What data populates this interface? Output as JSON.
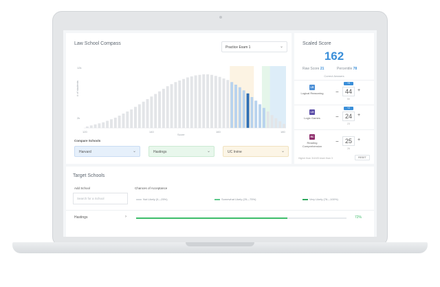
{
  "compass": {
    "title": "Law School Compass",
    "exam_select": "Practice Exam 1",
    "compare_label": "Compare Schools",
    "compare_schools": [
      "Harvard",
      "Hastings",
      "UC Irvine"
    ]
  },
  "chart_data": {
    "type": "bar",
    "ylabel": "# of students",
    "xlabel": "Score",
    "x_ticks": [
      "120",
      "140",
      "160",
      "180"
    ],
    "y_ticks": [
      "12k",
      "2k"
    ],
    "values": [
      0.3,
      0.5,
      0.7,
      0.9,
      1.1,
      1.4,
      1.7,
      2.0,
      2.4,
      2.8,
      3.2,
      3.6,
      4.1,
      4.6,
      5.1,
      5.6,
      6.1,
      6.6,
      7.1,
      7.6,
      8.1,
      8.5,
      8.9,
      9.2,
      9.5,
      9.8,
      10.0,
      10.2,
      10.3,
      10.4,
      10.4,
      10.3,
      10.1,
      9.9,
      9.6,
      9.3,
      8.9,
      8.4,
      7.9,
      7.3,
      6.7,
      6.0,
      5.3,
      4.6,
      3.9,
      3.2,
      2.5,
      1.9,
      1.3,
      0.8
    ],
    "ylim": [
      0,
      12
    ],
    "highlight_index": 40,
    "colors": {
      "bar": "#e3e5e8",
      "highlight_bar": "#b9d3ee",
      "selected_bar": "#2f6fb4",
      "harvard_band": "#dcebfa",
      "hastings_band": "#e1f4e6",
      "irvine_band": "#fbf1de"
    }
  },
  "scaled": {
    "title": "Scaled Score",
    "score": "162",
    "raw_label": "Raw Score",
    "raw_value": "21",
    "percentile_label": "Percentile",
    "percentile_value": "78",
    "correct_label": "Correct Answers",
    "sections": [
      {
        "abbr": "LR",
        "name": "Logical Reasoning",
        "delta": "+9",
        "value": "44",
        "total": "50",
        "color": "#4c8fd6"
      },
      {
        "abbr": "LG",
        "name": "Logic Games",
        "delta": "+2",
        "value": "24",
        "total": "23",
        "color": "#5b4da8"
      },
      {
        "abbr": "RC",
        "name": "Reading Comprehension",
        "delta": "",
        "value": "25",
        "total": "26",
        "color": "#8e2d6c"
      }
    ],
    "foot_text": "Higher than 3/4/4/5 lower than 3",
    "reset_label": "RESET"
  },
  "targets": {
    "title": "Target Schools",
    "add_label": "Add School",
    "chances_label": "Chances of Acceptance",
    "search_placeholder": "Search for a School",
    "legend": [
      {
        "label": "Not Likely (0—25%)",
        "color": "#d5d8dc"
      },
      {
        "label": "Somewhat Likely (25—75%)",
        "color": "#5cc98a"
      },
      {
        "label": "Very Likely (76—100%)",
        "color": "#2ea85c"
      }
    ],
    "rows": [
      {
        "name": "Hastings",
        "percent": "72%",
        "fill": 0.72
      }
    ]
  }
}
